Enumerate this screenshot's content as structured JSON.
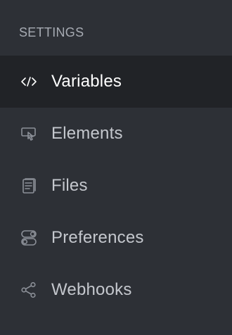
{
  "section": {
    "title": "SETTINGS"
  },
  "nav": {
    "items": [
      {
        "label": "Variables",
        "icon": "code-icon",
        "active": true
      },
      {
        "label": "Elements",
        "icon": "element-cursor-icon",
        "active": false
      },
      {
        "label": "Files",
        "icon": "file-icon",
        "active": false
      },
      {
        "label": "Preferences",
        "icon": "toggles-icon",
        "active": false
      },
      {
        "label": "Webhooks",
        "icon": "share-icon",
        "active": false
      }
    ]
  },
  "colors": {
    "background": "#2d3036",
    "active_background": "#212327",
    "text": "#c4c7cd",
    "active_text": "#ffffff",
    "header_text": "#a7abb3",
    "icon": "#8c9098"
  }
}
